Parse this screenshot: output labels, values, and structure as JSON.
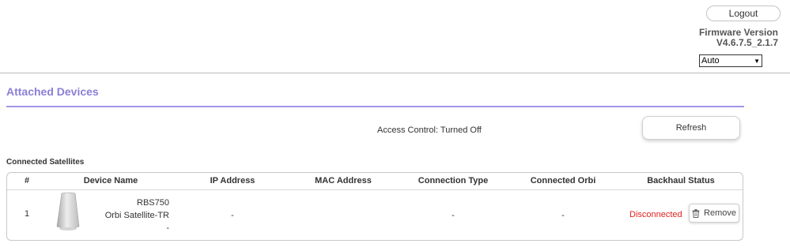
{
  "header": {
    "logout_label": "Logout",
    "firmware_label": "Firmware Version",
    "firmware_version": "V4.6.7.5_2.1.7",
    "language_selected": "Auto"
  },
  "page": {
    "title": "Attached Devices",
    "access_control_text": "Access Control: Turned Off",
    "refresh_label": "Refresh",
    "section_title": "Connected Satellites"
  },
  "table": {
    "columns": [
      "#",
      "Device Name",
      "IP Address",
      "MAC Address",
      "Connection Type",
      "Connected Orbi",
      "Backhaul Status"
    ],
    "rows": [
      {
        "index": "1",
        "model": "RBS750",
        "name": "Orbi Satellite-TR",
        "extra": "-",
        "ip": "-",
        "mac": "",
        "connection_type": "-",
        "connected_orbi": "-",
        "backhaul_status": "Disconnected",
        "remove_label": "Remove"
      }
    ]
  },
  "colors": {
    "accent": "#8b7fd6",
    "accent_rule": "#a394e6",
    "status_disconnected": "#e02020"
  },
  "icons": [
    "chevron-down-icon",
    "trash-icon",
    "satellite-device-image"
  ]
}
